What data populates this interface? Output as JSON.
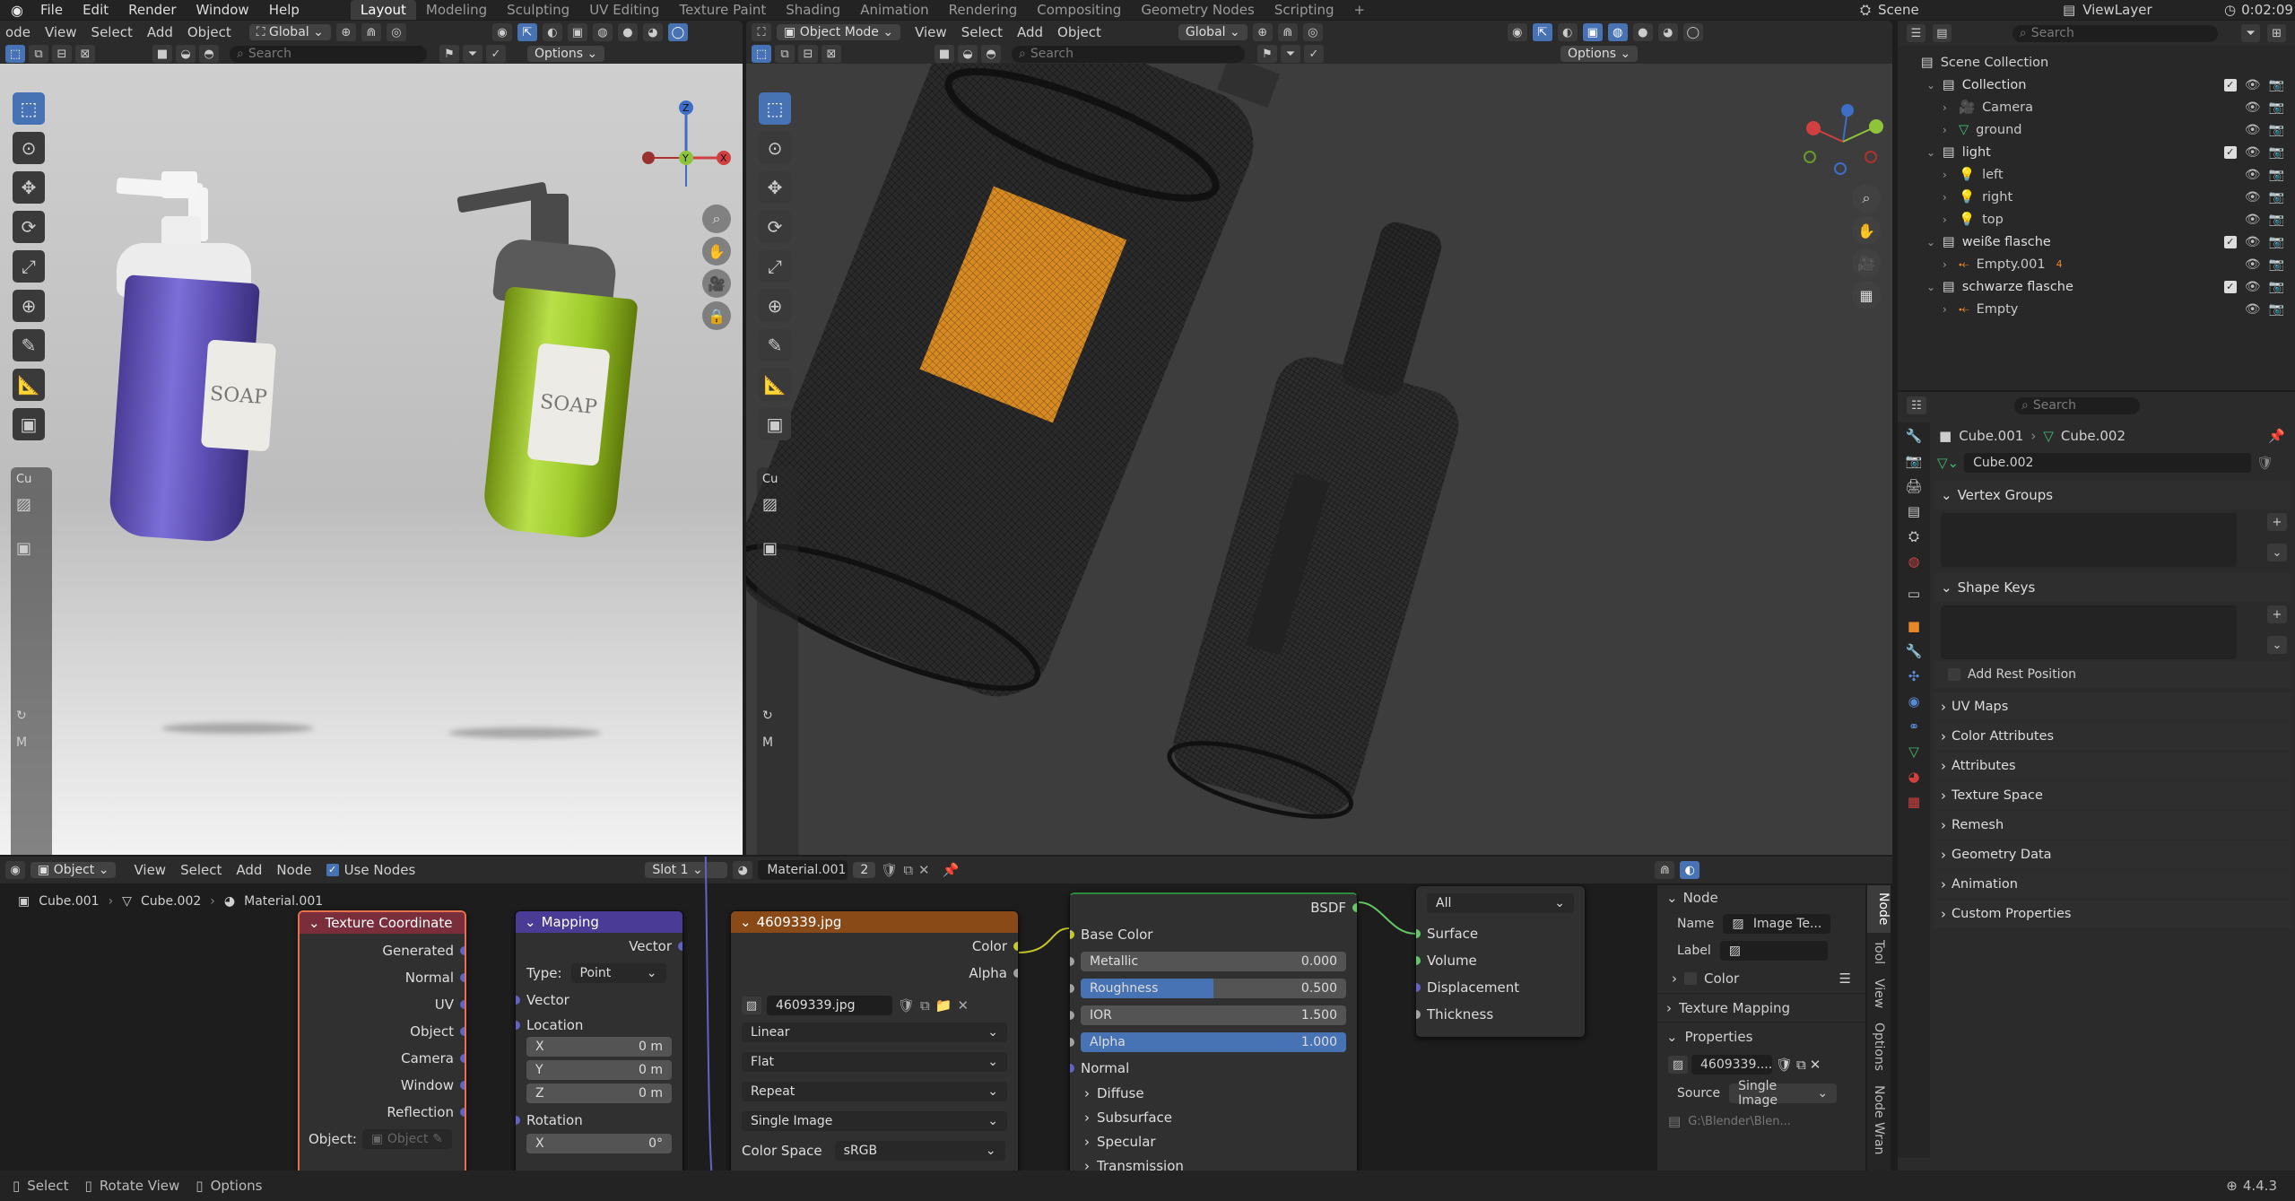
{
  "topbar": {
    "menus": [
      "File",
      "Edit",
      "Render",
      "Window",
      "Help"
    ],
    "workspaces": [
      "Layout",
      "Modeling",
      "Sculpting",
      "UV Editing",
      "Texture Paint",
      "Shading",
      "Animation",
      "Rendering",
      "Compositing",
      "Geometry Nodes",
      "Scripting"
    ],
    "add_workspace": "+",
    "scene": "Scene",
    "view_layer": "ViewLayer",
    "time": "0:02:09"
  },
  "left_viewport": {
    "header_menus": [
      "ode",
      "View",
      "Select",
      "Add",
      "Object"
    ],
    "orientation": "Global",
    "search_placeholder": "Search",
    "options": "Options",
    "toolbar_collapsed_label": "Cu",
    "mode_label": "M",
    "gizmo": {
      "z": "Z",
      "y": "Y",
      "x": "X"
    },
    "bottle_label": "SOAP",
    "bottle_label2": "SOAP"
  },
  "right_viewport": {
    "mode": "Object Mode",
    "header_menus": [
      "View",
      "Select",
      "Add",
      "Object"
    ],
    "orientation": "Global",
    "search_placeholder": "Search",
    "options": "Options",
    "toolbar_collapsed_label": "Cu",
    "mode_label": "M"
  },
  "outliner": {
    "search_placeholder": "Search",
    "root": "Scene Collection",
    "items": [
      {
        "label": "Collection",
        "indent": 1,
        "type": "collection",
        "expanded": true
      },
      {
        "label": "Camera",
        "indent": 2,
        "type": "camera"
      },
      {
        "label": "ground",
        "indent": 2,
        "type": "mesh"
      },
      {
        "label": "light",
        "indent": 1,
        "type": "collection",
        "expanded": true
      },
      {
        "label": "left",
        "indent": 2,
        "type": "light"
      },
      {
        "label": "right",
        "indent": 2,
        "type": "light"
      },
      {
        "label": "top",
        "indent": 2,
        "type": "light"
      },
      {
        "label": "weiße flasche",
        "indent": 1,
        "type": "collection",
        "expanded": true
      },
      {
        "label": "Empty.001",
        "indent": 2,
        "type": "empty",
        "badge": "4"
      },
      {
        "label": "schwarze flasche",
        "indent": 1,
        "type": "collection",
        "expanded": true
      },
      {
        "label": "Empty",
        "indent": 2,
        "type": "empty"
      }
    ]
  },
  "properties": {
    "search_placeholder": "Search",
    "breadcrumb_object": "Cube.001",
    "breadcrumb_data": "Cube.002",
    "data_name": "Cube.002",
    "panels_open": [
      "Vertex Groups",
      "Shape Keys"
    ],
    "add_rest_position": "Add Rest Position",
    "panels_closed": [
      "UV Maps",
      "Color Attributes",
      "Attributes",
      "Texture Space",
      "Remesh",
      "Geometry Data",
      "Animation",
      "Custom Properties"
    ]
  },
  "node_editor": {
    "editor_type": "Object",
    "menus": [
      "View",
      "Select",
      "Add",
      "Node"
    ],
    "use_nodes": "Use Nodes",
    "slot": "Slot 1",
    "material": "Material.001",
    "users": "2",
    "breadcrumb": [
      "Cube.001",
      "Cube.002",
      "Material.001"
    ],
    "texcoord": {
      "title": "Texture Coordinate",
      "outputs": [
        "Generated",
        "Normal",
        "UV",
        "Object",
        "Camera",
        "Window",
        "Reflection"
      ],
      "object_label": "Object:",
      "object_placeholder": "Object"
    },
    "mapping": {
      "title": "Mapping",
      "output": "Vector",
      "type_label": "Type:",
      "type_value": "Point",
      "vector": "Vector",
      "location": "Location",
      "loc": [
        {
          "axis": "X",
          "value": "0 m"
        },
        {
          "axis": "Y",
          "value": "0 m"
        },
        {
          "axis": "Z",
          "value": "0 m"
        }
      ],
      "rotation": "Rotation",
      "rot_x": {
        "axis": "X",
        "value": "0°"
      }
    },
    "image": {
      "title": "4609339.jpg",
      "out_color": "Color",
      "out_alpha": "Alpha",
      "file": "4609339.jpg",
      "interp": "Linear",
      "proj": "Flat",
      "ext": "Repeat",
      "source": "Single Image",
      "cs_label": "Color Space",
      "cs_value": "sRGB"
    },
    "bsdf": {
      "out": "BSDF",
      "base_color": "Base Color",
      "metallic": {
        "label": "Metallic",
        "value": "0.000",
        "fill": 0
      },
      "roughness": {
        "label": "Roughness",
        "value": "0.500",
        "fill": 0.5
      },
      "ior": {
        "label": "IOR",
        "value": "1.500",
        "fill": 0
      },
      "alpha": {
        "label": "Alpha",
        "value": "1.000",
        "fill": 1
      },
      "normal": "Normal",
      "sub": [
        "Diffuse",
        "Subsurface",
        "Specular",
        "Transmission"
      ]
    },
    "output": {
      "target": "All",
      "inputs": [
        "Surface",
        "Volume",
        "Displacement",
        "Thickness"
      ]
    },
    "sidebar": {
      "node_header": "Node",
      "name_label": "Name",
      "name_value": "Image Te...",
      "label_label": "Label",
      "color": "Color",
      "texture_mapping": "Texture Mapping",
      "properties": "Properties",
      "image_name": "4609339....",
      "source_label": "Source",
      "source_value": "Single Image",
      "path": "G:\\Blender\\Blen...",
      "tabs": [
        "Node",
        "Tool",
        "View",
        "Options",
        "Node Wran"
      ]
    }
  },
  "statusbar": {
    "select": "Select",
    "rotate": "Rotate View",
    "options": "Options",
    "version": "4.4.3"
  }
}
